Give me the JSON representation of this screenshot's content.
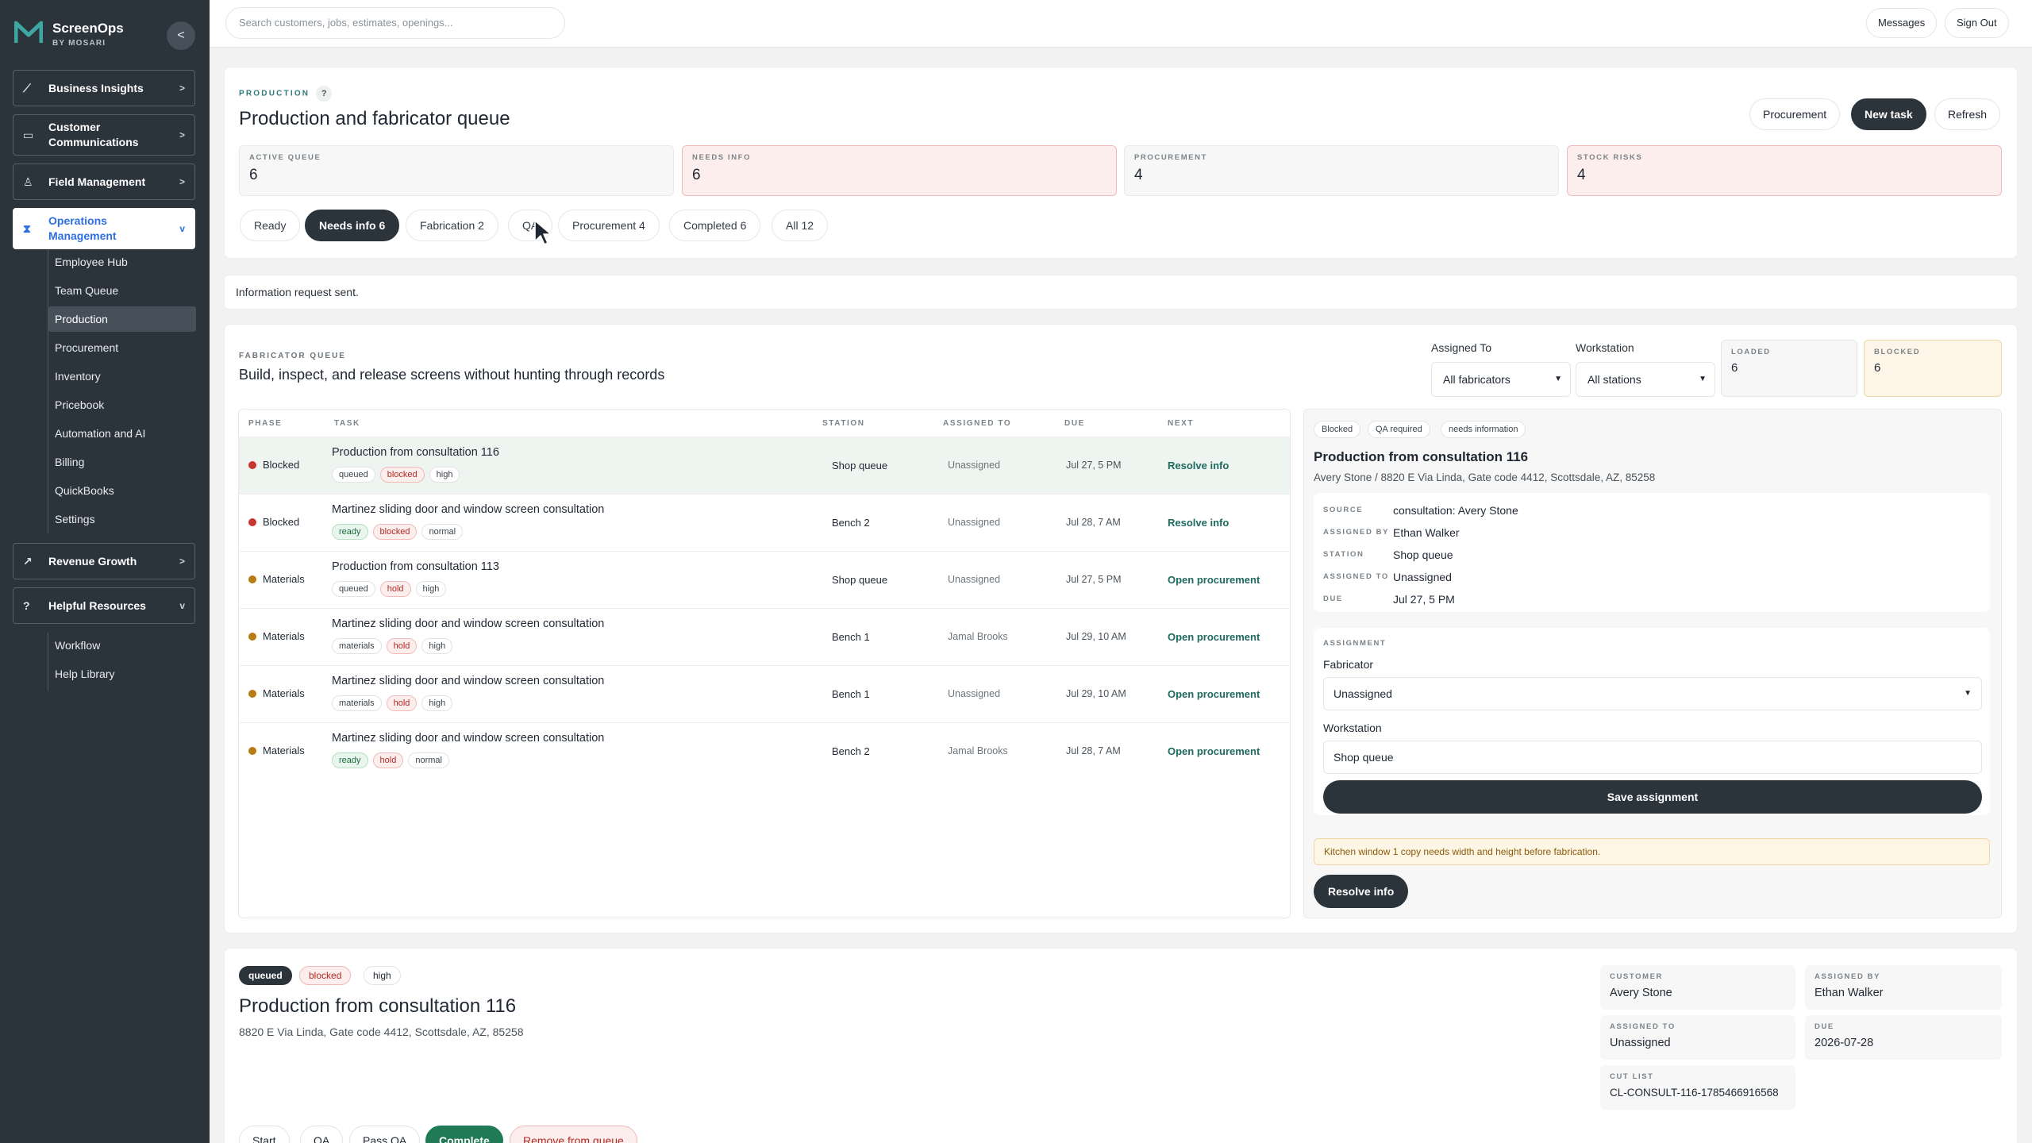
{
  "brand": {
    "name": "ScreenOps",
    "sub": "BY MOSARI",
    "collapse": "<"
  },
  "sidebar": {
    "groups": [
      {
        "label": "Business Insights",
        "icon": "chart-icon",
        "chev": ">"
      },
      {
        "label": "Customer Communications",
        "icon": "chat-icon",
        "chev": ">"
      },
      {
        "label": "Field Management",
        "icon": "person-icon",
        "chev": ">"
      },
      {
        "label": "Operations Management",
        "icon": "hourglass-icon",
        "chev": "v"
      },
      {
        "label": "Revenue Growth",
        "icon": "trend-icon",
        "chev": ">"
      },
      {
        "label": "Helpful Resources",
        "icon": "help-circle-icon",
        "chev": "v"
      }
    ],
    "ops_items": [
      "Employee Hub",
      "Team Queue",
      "Production",
      "Procurement",
      "Inventory",
      "Pricebook",
      "Automation and AI",
      "Billing",
      "QuickBooks",
      "Settings"
    ],
    "help_items": [
      "Workflow",
      "Help Library"
    ]
  },
  "topbar": {
    "search_placeholder": "Search customers, jobs, estimates, openings...",
    "messages": "Messages",
    "sign_out": "Sign Out"
  },
  "production": {
    "eyebrow": "PRODUCTION",
    "help": "?",
    "title": "Production and fabricator queue",
    "buttons": {
      "procurement": "Procurement",
      "new_task": "New task",
      "refresh": "Refresh"
    },
    "stats": [
      {
        "label": "ACTIVE QUEUE",
        "value": "6"
      },
      {
        "label": "NEEDS INFO",
        "value": "6"
      },
      {
        "label": "PROCUREMENT",
        "value": "4"
      },
      {
        "label": "STOCK RISKS",
        "value": "4"
      }
    ],
    "tabs": [
      "Ready",
      "Needs info 6",
      "Fabrication 2",
      "QA",
      "Procurement 4",
      "Completed 6",
      "All 12"
    ]
  },
  "notice": "Information request sent.",
  "queue": {
    "eyebrow": "FABRICATOR QUEUE",
    "title": "Build, inspect, and release screens without hunting through records",
    "assigned_label": "Assigned To",
    "assigned_value": "All fabricators",
    "workstation_label": "Workstation",
    "workstation_value": "All stations",
    "loaded_label": "LOADED",
    "loaded_value": "6",
    "blocked_label": "BLOCKED",
    "blocked_value": "6",
    "headers": [
      "PHASE",
      "TASK",
      "STATION",
      "ASSIGNED TO",
      "DUE",
      "NEXT"
    ],
    "rows": [
      {
        "phase": "Blocked",
        "task": "Production from consultation 116",
        "c1": "queued",
        "c2": "blocked",
        "c3": "high",
        "station": "Shop queue",
        "assigned": "Unassigned",
        "due": "Jul 27, 5 PM",
        "next": "Resolve info"
      },
      {
        "phase": "Blocked",
        "task": "Martinez sliding door and window screen consultation",
        "c1": "ready",
        "c2": "blocked",
        "c3": "normal",
        "station": "Bench 2",
        "assigned": "Unassigned",
        "due": "Jul 28, 7 AM",
        "next": "Resolve info"
      },
      {
        "phase": "Materials",
        "task": "Production from consultation 113",
        "c1": "queued",
        "c2": "hold",
        "c3": "high",
        "station": "Shop queue",
        "assigned": "Unassigned",
        "due": "Jul 27, 5 PM",
        "next": "Open procurement"
      },
      {
        "phase": "Materials",
        "task": "Martinez sliding door and window screen consultation",
        "c1": "materials",
        "c2": "hold",
        "c3": "high",
        "station": "Bench 1",
        "assigned": "Jamal Brooks",
        "due": "Jul 29, 10 AM",
        "next": "Open procurement"
      },
      {
        "phase": "Materials",
        "task": "Martinez sliding door and window screen consultation",
        "c1": "materials",
        "c2": "hold",
        "c3": "high",
        "station": "Bench 1",
        "assigned": "Unassigned",
        "due": "Jul 29, 10 AM",
        "next": "Open procurement"
      },
      {
        "phase": "Materials",
        "task": "Martinez sliding door and window screen consultation",
        "c1": "ready",
        "c2": "hold",
        "c3": "normal",
        "station": "Bench 2",
        "assigned": "Jamal Brooks",
        "due": "Jul 28, 7 AM",
        "next": "Open procurement"
      }
    ]
  },
  "detail": {
    "chips": [
      "Blocked",
      "QA required",
      "needs information"
    ],
    "title": "Production from consultation 116",
    "address": "Avery Stone / 8820 E Via Linda, Gate code 4412, Scottsdale, AZ, 85258",
    "source_k": "SOURCE",
    "source_v": "consultation: Avery Stone",
    "by_k": "ASSIGNED BY",
    "by_v": "Ethan Walker",
    "station_k": "STATION",
    "station_v": "Shop queue",
    "to_k": "ASSIGNED TO",
    "to_v": "Unassigned",
    "due_k": "DUE",
    "due_v": "Jul 27, 5 PM",
    "assignment": "ASSIGNMENT",
    "fabricator_label": "Fabricator",
    "fabricator_value": "Unassigned",
    "workstation_label": "Workstation",
    "workstation_value": "Shop queue",
    "save": "Save assignment",
    "warning": "Kitchen window 1 copy needs width and height before fabrication.",
    "resolve": "Resolve info"
  },
  "task": {
    "tags": [
      "queued",
      "blocked",
      "high"
    ],
    "title": "Production from consultation 116",
    "address": "8820 E Via Linda, Gate code 4412, Scottsdale, AZ, 85258",
    "customer_k": "CUSTOMER",
    "customer_v": "Avery Stone",
    "by_k": "ASSIGNED BY",
    "by_v": "Ethan Walker",
    "to_k": "ASSIGNED TO",
    "to_v": "Unassigned",
    "due_k": "DUE",
    "due_v": "2026-07-28",
    "cut_k": "CUT LIST",
    "cut_v": "CL-CONSULT-116-1785466916568",
    "actions": [
      "Start",
      "QA",
      "Pass QA",
      "Complete",
      "Remove from queue"
    ]
  }
}
